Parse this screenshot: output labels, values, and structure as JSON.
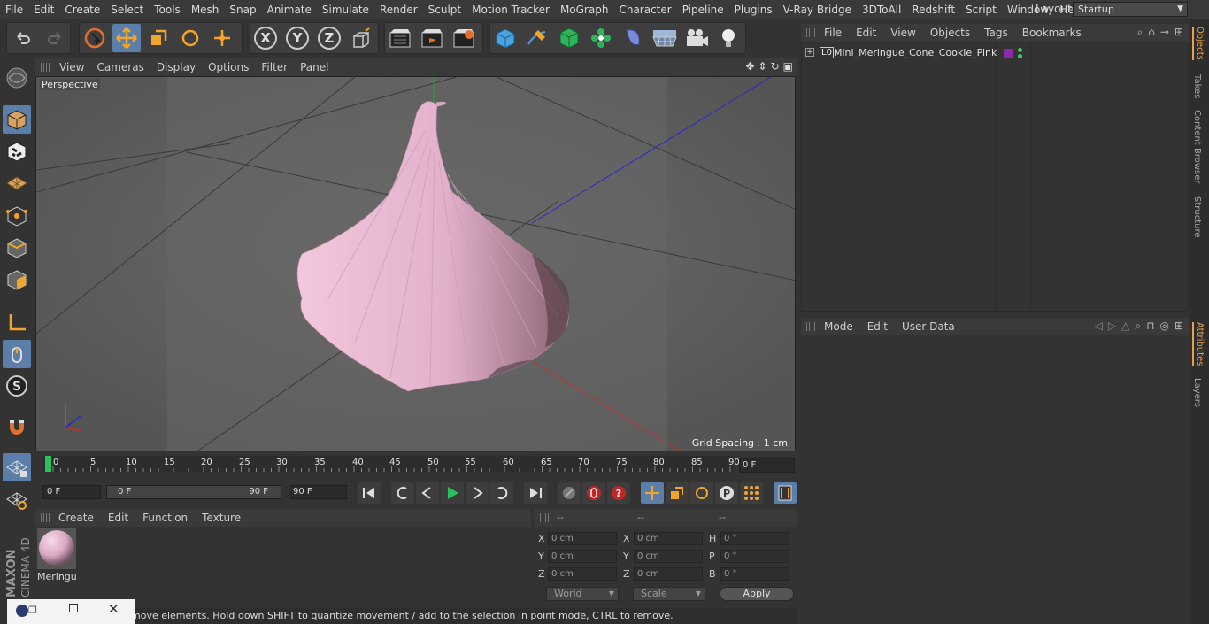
{
  "menubar": {
    "items": [
      "File",
      "Edit",
      "Create",
      "Select",
      "Tools",
      "Mesh",
      "Snap",
      "Animate",
      "Simulate",
      "Render",
      "Sculpt",
      "Motion Tracker",
      "MoGraph",
      "Character",
      "Pipeline",
      "Plugins",
      "V-Ray Bridge",
      "3DToAll",
      "Redshift",
      "Script",
      "Window",
      "Help"
    ],
    "layout_label": "Layout:",
    "layout_value": "Startup"
  },
  "toolbar": {
    "axis_x": "X",
    "axis_y": "Y",
    "axis_z": "Z"
  },
  "viewport": {
    "menu": [
      "View",
      "Cameras",
      "Display",
      "Options",
      "Filter",
      "Panel"
    ],
    "label": "Perspective",
    "grid_spacing": "Grid Spacing : 1 cm",
    "object_color": "#e8bcd3"
  },
  "timeline": {
    "ticks": [
      "0",
      "5",
      "10",
      "15",
      "20",
      "25",
      "30",
      "35",
      "40",
      "45",
      "50",
      "55",
      "60",
      "65",
      "70",
      "75",
      "80",
      "85",
      "90"
    ],
    "current_frame": "0 F"
  },
  "transport": {
    "start_field": "0 F",
    "range_start": "0 F",
    "range_end": "90 F",
    "end_field": "90 F"
  },
  "material": {
    "menu": [
      "Create",
      "Edit",
      "Function",
      "Texture"
    ],
    "item_label": "Meringu"
  },
  "coords": {
    "headers": [
      "--",
      "--",
      "--"
    ],
    "pos": [
      {
        "axis": "X",
        "value": "0 cm"
      },
      {
        "axis": "Y",
        "value": "0 cm"
      },
      {
        "axis": "Z",
        "value": "0 cm"
      }
    ],
    "size": [
      {
        "axis": "X",
        "value": "0 cm"
      },
      {
        "axis": "Y",
        "value": "0 cm"
      },
      {
        "axis": "Z",
        "value": "0 cm"
      }
    ],
    "rot": [
      {
        "axis": "H",
        "value": "0 °"
      },
      {
        "axis": "P",
        "value": "0 °"
      },
      {
        "axis": "B",
        "value": "0 °"
      }
    ],
    "world": "World",
    "scale": "Scale",
    "apply": "Apply"
  },
  "status": {
    "text": "move elements. Hold down SHIFT to quantize movement / add to the selection in point mode, CTRL to remove."
  },
  "objects": {
    "menu": [
      "File",
      "Edit",
      "View",
      "Objects",
      "Tags",
      "Bookmarks"
    ],
    "item_name": "Mini_Meringue_Cone_Cookie_Pink",
    "layer_icon": "L0"
  },
  "attributes": {
    "menu": [
      "Mode",
      "Edit",
      "User Data"
    ]
  },
  "side_tabs": [
    "Objects",
    "Takes",
    "Content Browser",
    "Structure",
    "Attributes",
    "Layers"
  ],
  "brand": {
    "maxon": "MAXON",
    "product": "CINEMA 4D"
  }
}
